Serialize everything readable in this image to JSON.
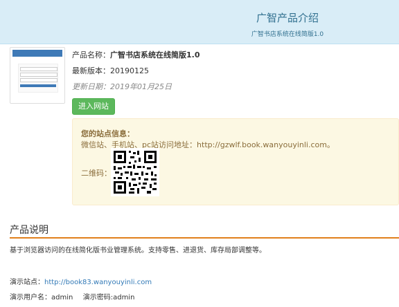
{
  "header": {
    "title": "广智产品介绍",
    "subtitle": "广智书店系统在线简版1.0"
  },
  "product": {
    "name_label": "产品名称：",
    "name_value": "广智书店系统在线简版1.0",
    "version_label": "最新版本：",
    "version_value": "20190125",
    "date_label": "更新日期：",
    "date_value": "2019年01月25日",
    "enter_button": "进入网站"
  },
  "site_info": {
    "heading": "您的站点信息：",
    "address": "微信站、手机站、pc站访问地址：http://gzwlf.book.wanyouyinli.com。",
    "qr_label": "二维码："
  },
  "description": {
    "title": "产品说明",
    "text": "基于浏览器访问的在线简化版书业管理系统。支持零售、进退货、库存局部调整等。",
    "demo_site_label": "演示站点：",
    "demo_site_url": "http://book83.wanyouyinli.com",
    "demo_user_label": "演示用户名：",
    "demo_user_value": "admin",
    "demo_pwd_label": "演示密码:",
    "demo_pwd_value": "admin"
  },
  "colors": {
    "header_bg": "#d9edf7",
    "button_green": "#5cb85c",
    "panel_bg": "#fcf8e3",
    "section_rule": "#e17f1b",
    "link": "#337ab7"
  },
  "icons": [
    "qr-code-icon"
  ]
}
